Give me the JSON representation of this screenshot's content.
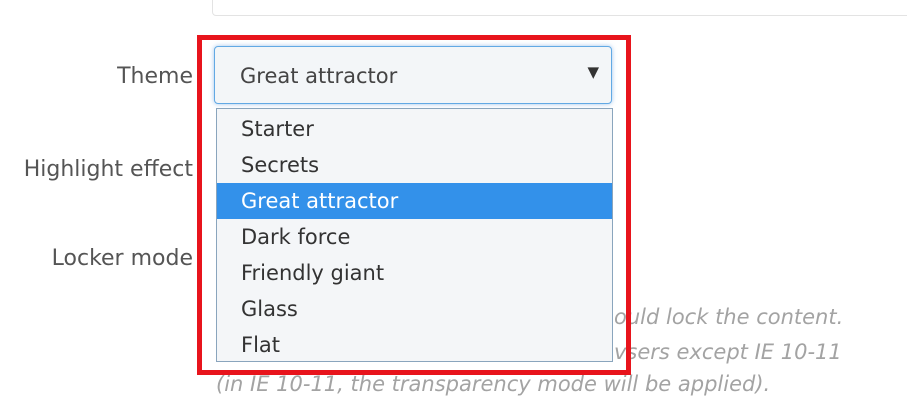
{
  "labels": {
    "theme": "Theme",
    "highlight_effect": "Highlight effect",
    "locker_mode": "Locker mode"
  },
  "theme_select": {
    "value": "Great attractor",
    "arrow_icon": "triangle-down-icon"
  },
  "dropdown": {
    "options": [
      "Starter",
      "Secrets",
      "Great attractor",
      "Dark force",
      "Friendly giant",
      "Glass",
      "Flat"
    ],
    "selected": "Great attractor"
  },
  "help_text": {
    "line1": "ould lock the content.",
    "line2": "vsers except IE 10-11",
    "line3": "(in IE 10-11, the transparency mode will be applied)."
  },
  "colors": {
    "highlight_frame": "#e8141c",
    "selected_option": "#3391ea",
    "focus_border": "#62a9e4"
  }
}
